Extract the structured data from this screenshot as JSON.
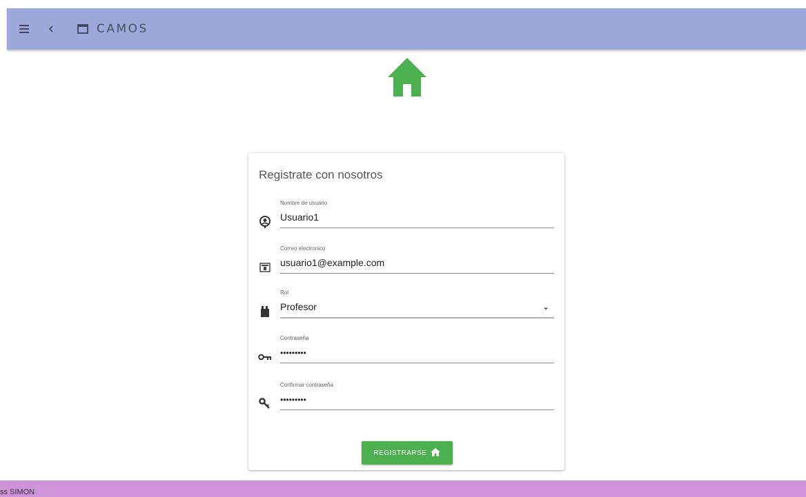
{
  "toolbar": {
    "title": "CAMOS",
    "menu_icon": "menu-icon",
    "back_icon": "chevron-left-icon",
    "window_icon": "window-icon",
    "background": "#9fa8da"
  },
  "hero": {
    "icon": "home-icon",
    "color": "#4caf50"
  },
  "form": {
    "title": "Registrate con nosotros",
    "fields": [
      {
        "label": "Nombre de usuario",
        "value": "Usuario1",
        "icon": "account-circle-icon"
      },
      {
        "label": "Correo electronico",
        "value": "usuario1@example.com",
        "icon": "email-icon"
      },
      {
        "label": "Rol",
        "value": "Profesor",
        "icon": "role-icon"
      },
      {
        "label": "Contraseña",
        "value": "•••••••••",
        "icon": "key-icon"
      },
      {
        "label": "Confirmar contraseña",
        "value": "•••••••••",
        "icon": "vpn-key-icon"
      }
    ],
    "submit": {
      "label": "REGISTRARSE",
      "icon": "home-icon",
      "color": "#4caf50"
    }
  },
  "footer": {
    "text": "ss SIMON",
    "background": "#ce93d8"
  }
}
